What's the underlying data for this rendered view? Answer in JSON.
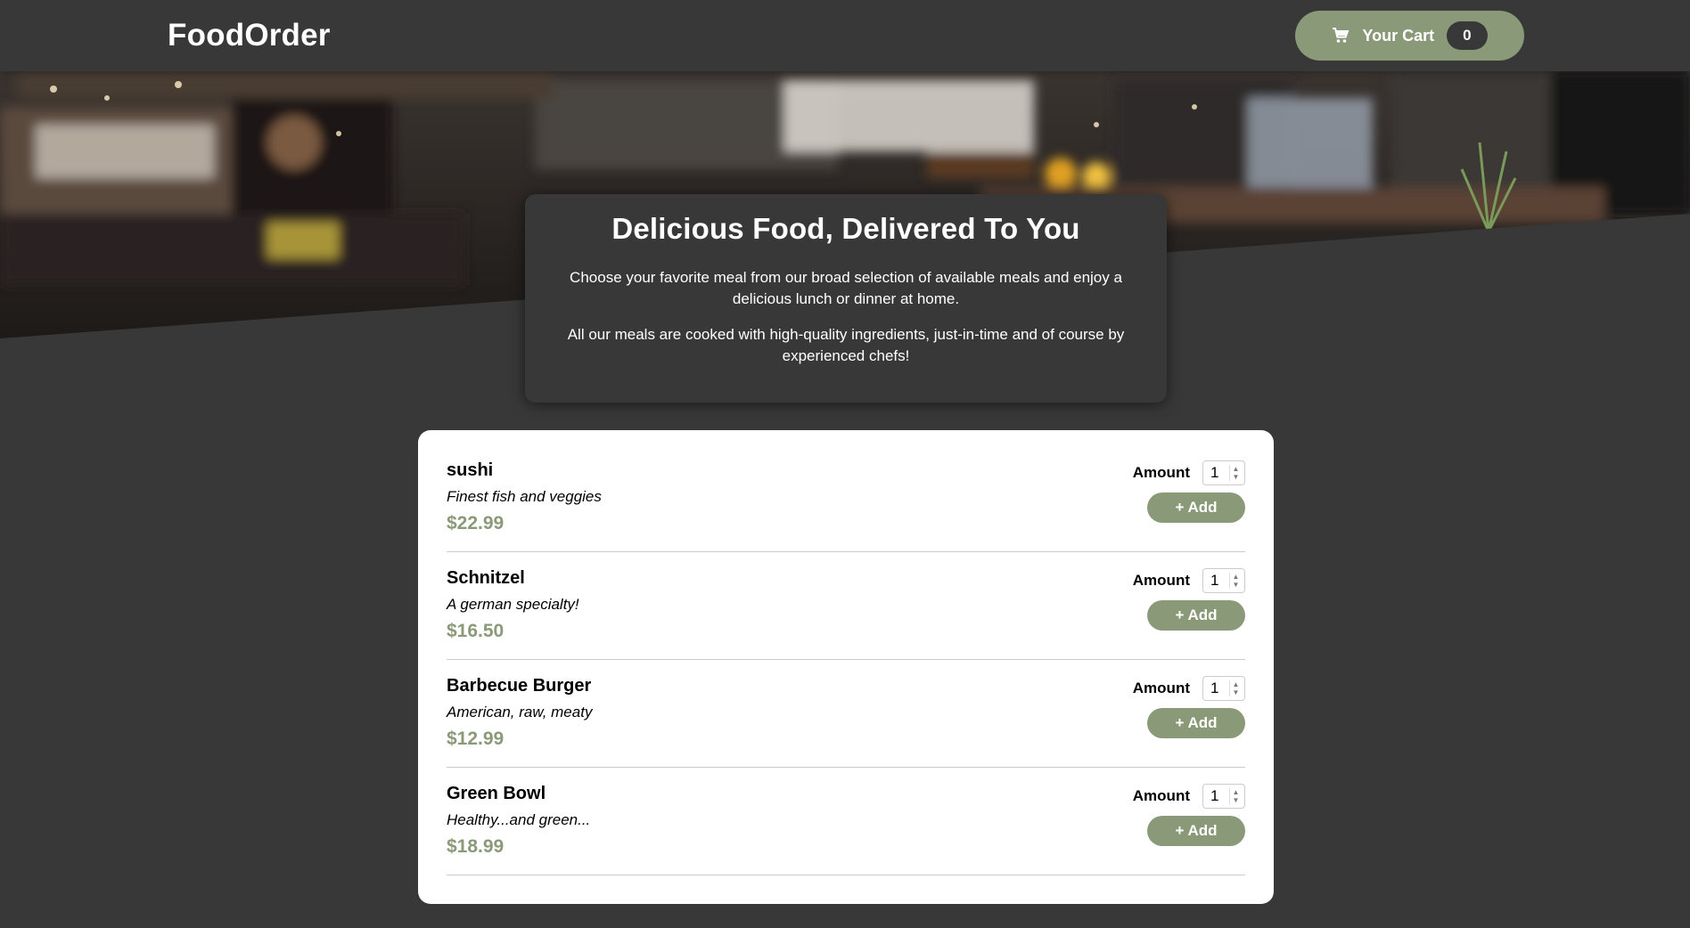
{
  "header": {
    "brand": "FoodOrder",
    "cart_label": "Your Cart",
    "cart_count": "0",
    "accent": "#8a9a78"
  },
  "summary": {
    "title": "Delicious Food, Delivered To You",
    "paragraph_1": "Choose your favorite meal from our broad selection of available meals and enjoy a delicious lunch or dinner at home.",
    "paragraph_2": "All our meals are cooked with high-quality ingredients, just-in-time and of course by experienced chefs!"
  },
  "meals": [
    {
      "name": "sushi",
      "description": "Finest fish and veggies",
      "price": "$22.99",
      "amount_label": "Amount",
      "amount_value": "1",
      "add_label": "+ Add"
    },
    {
      "name": "Schnitzel",
      "description": "A german specialty!",
      "price": "$16.50",
      "amount_label": "Amount",
      "amount_value": "1",
      "add_label": "+ Add"
    },
    {
      "name": "Barbecue Burger",
      "description": "American, raw, meaty",
      "price": "$12.99",
      "amount_label": "Amount",
      "amount_value": "1",
      "add_label": "+ Add"
    },
    {
      "name": "Green Bowl",
      "description": "Healthy...and green...",
      "price": "$18.99",
      "amount_label": "Amount",
      "amount_value": "1",
      "add_label": "+ Add"
    }
  ],
  "colors": {
    "background": "#383838",
    "accent": "#8a9a78",
    "card": "#ffffff"
  },
  "icons": {
    "cart": "shopping-cart-icon"
  }
}
